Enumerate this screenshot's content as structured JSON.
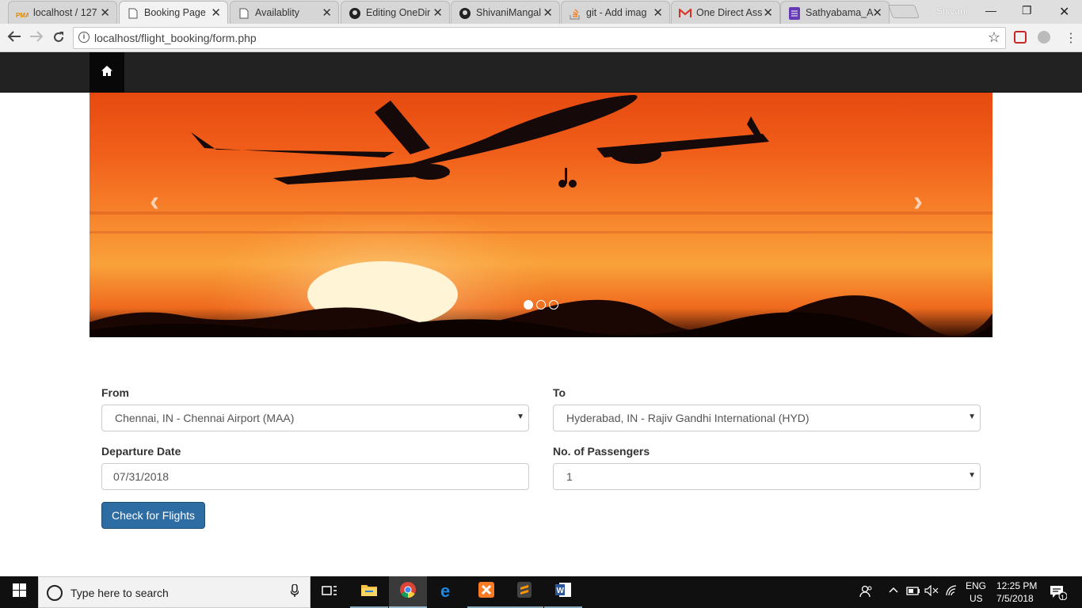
{
  "browser": {
    "tabs": [
      {
        "title": "localhost / 127",
        "icon": "phpmyadmin-icon",
        "active": false
      },
      {
        "title": "Booking Page",
        "icon": "page-icon",
        "active": true
      },
      {
        "title": "Availablity",
        "icon": "page-icon",
        "active": false
      },
      {
        "title": "Editing OneDir",
        "icon": "github-icon",
        "active": false
      },
      {
        "title": "ShivaniMangal",
        "icon": "github-icon",
        "active": false
      },
      {
        "title": "git - Add imag",
        "icon": "stackoverflow-icon",
        "active": false
      },
      {
        "title": "One Direct Ass",
        "icon": "gmail-icon",
        "active": false
      },
      {
        "title": "Sathyabama_A",
        "icon": "forms-icon",
        "active": false
      }
    ],
    "user": "Shivani",
    "url": "localhost/flight_booking/form.php"
  },
  "site": {
    "carousel": {
      "slides": 3,
      "active_slide": 1
    },
    "form": {
      "from_label": "From",
      "from_value": "Chennai, IN - Chennai Airport (MAA)",
      "to_label": "To",
      "to_value": "Hyderabad, IN - Rajiv Gandhi International (HYD)",
      "date_label": "Departure Date",
      "date_value": "07/31/2018",
      "passengers_label": "No. of Passengers",
      "passengers_value": "1",
      "submit_label": "Check for Flights"
    }
  },
  "taskbar": {
    "search_placeholder": "Type here to search",
    "lang": "ENG",
    "region": "US",
    "time": "12:25 PM",
    "date": "7/5/2018",
    "notifications": "1"
  },
  "colors": {
    "navbar": "#222222",
    "primary_button": "#2e6da4",
    "sunset_orange": "#f15f1a"
  }
}
